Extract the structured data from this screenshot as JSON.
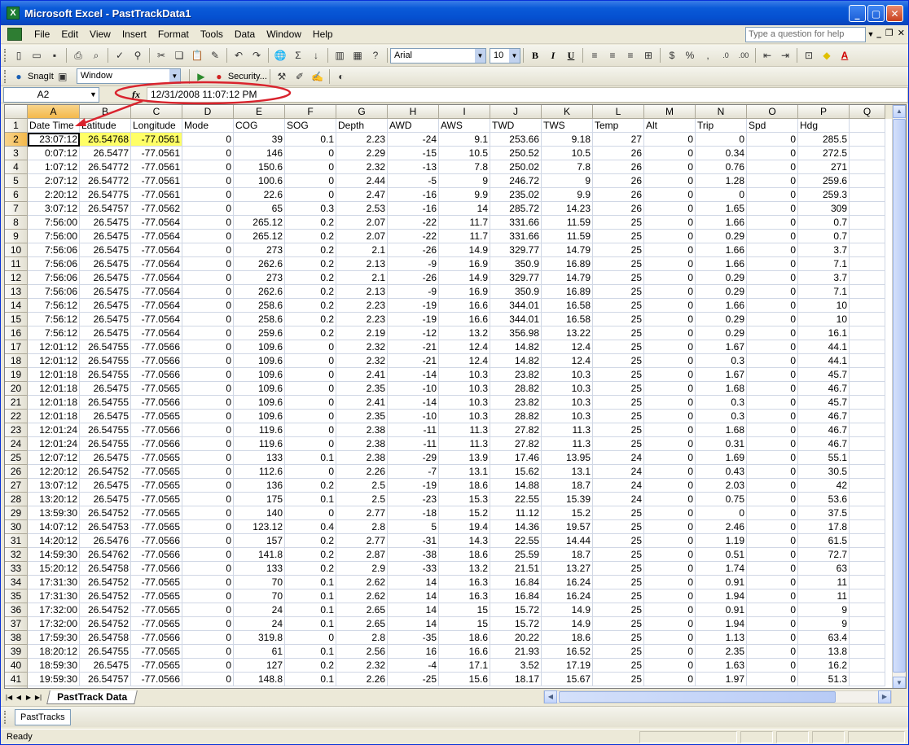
{
  "window": {
    "title": "Microsoft Excel - PastTrackData1"
  },
  "menu": {
    "items": [
      "File",
      "Edit",
      "View",
      "Insert",
      "Format",
      "Tools",
      "Data",
      "Window",
      "Help"
    ],
    "help_placeholder": "Type a question for help"
  },
  "toolbar": {
    "font": "Arial",
    "size": "10",
    "snagit_label": "SnagIt",
    "window_select": "Window",
    "security_label": "Security..."
  },
  "formula_bar": {
    "name_box": "A2",
    "fx": "fx",
    "value": "12/31/2008  11:07:12 PM"
  },
  "grid": {
    "columns": [
      "A",
      "B",
      "C",
      "D",
      "E",
      "F",
      "G",
      "H",
      "I",
      "J",
      "K",
      "L",
      "M",
      "N",
      "O",
      "P",
      "Q"
    ],
    "header_row": [
      "Date Time",
      "Latitude",
      "Longitude",
      "Mode",
      "COG",
      "SOG",
      "Depth",
      "AWD",
      "AWS",
      "TWD",
      "TWS",
      "Temp",
      "Alt",
      "Trip",
      "Spd",
      "Hdg"
    ],
    "rows": [
      [
        "23:07:12",
        "26.54768",
        "-77.0561",
        "0",
        "39",
        "0.1",
        "2.23",
        "-24",
        "9.1",
        "253.66",
        "9.18",
        "27",
        "0",
        "0",
        "0",
        "285.5"
      ],
      [
        "0:07:12",
        "26.5477",
        "-77.0561",
        "0",
        "146",
        "0",
        "2.29",
        "-15",
        "10.5",
        "250.52",
        "10.5",
        "26",
        "0",
        "0.34",
        "0",
        "272.5"
      ],
      [
        "1:07:12",
        "26.54772",
        "-77.0561",
        "0",
        "150.6",
        "0",
        "2.32",
        "-13",
        "7.8",
        "250.02",
        "7.8",
        "26",
        "0",
        "0.76",
        "0",
        "271"
      ],
      [
        "2:07:12",
        "26.54772",
        "-77.0561",
        "0",
        "100.6",
        "0",
        "2.44",
        "-5",
        "9",
        "246.72",
        "9",
        "26",
        "0",
        "1.28",
        "0",
        "259.6"
      ],
      [
        "2:20:12",
        "26.54775",
        "-77.0561",
        "0",
        "22.6",
        "0",
        "2.47",
        "-16",
        "9.9",
        "235.02",
        "9.9",
        "26",
        "0",
        "0",
        "0",
        "259.3"
      ],
      [
        "3:07:12",
        "26.54757",
        "-77.0562",
        "0",
        "65",
        "0.3",
        "2.53",
        "-16",
        "14",
        "285.72",
        "14.23",
        "26",
        "0",
        "1.65",
        "0",
        "309"
      ],
      [
        "7:56:00",
        "26.5475",
        "-77.0564",
        "0",
        "265.12",
        "0.2",
        "2.07",
        "-22",
        "11.7",
        "331.66",
        "11.59",
        "25",
        "0",
        "1.66",
        "0",
        "0.7"
      ],
      [
        "7:56:00",
        "26.5475",
        "-77.0564",
        "0",
        "265.12",
        "0.2",
        "2.07",
        "-22",
        "11.7",
        "331.66",
        "11.59",
        "25",
        "0",
        "0.29",
        "0",
        "0.7"
      ],
      [
        "7:56:06",
        "26.5475",
        "-77.0564",
        "0",
        "273",
        "0.2",
        "2.1",
        "-26",
        "14.9",
        "329.77",
        "14.79",
        "25",
        "0",
        "1.66",
        "0",
        "3.7"
      ],
      [
        "7:56:06",
        "26.5475",
        "-77.0564",
        "0",
        "262.6",
        "0.2",
        "2.13",
        "-9",
        "16.9",
        "350.9",
        "16.89",
        "25",
        "0",
        "1.66",
        "0",
        "7.1"
      ],
      [
        "7:56:06",
        "26.5475",
        "-77.0564",
        "0",
        "273",
        "0.2",
        "2.1",
        "-26",
        "14.9",
        "329.77",
        "14.79",
        "25",
        "0",
        "0.29",
        "0",
        "3.7"
      ],
      [
        "7:56:06",
        "26.5475",
        "-77.0564",
        "0",
        "262.6",
        "0.2",
        "2.13",
        "-9",
        "16.9",
        "350.9",
        "16.89",
        "25",
        "0",
        "0.29",
        "0",
        "7.1"
      ],
      [
        "7:56:12",
        "26.5475",
        "-77.0564",
        "0",
        "258.6",
        "0.2",
        "2.23",
        "-19",
        "16.6",
        "344.01",
        "16.58",
        "25",
        "0",
        "1.66",
        "0",
        "10"
      ],
      [
        "7:56:12",
        "26.5475",
        "-77.0564",
        "0",
        "258.6",
        "0.2",
        "2.23",
        "-19",
        "16.6",
        "344.01",
        "16.58",
        "25",
        "0",
        "0.29",
        "0",
        "10"
      ],
      [
        "7:56:12",
        "26.5475",
        "-77.0564",
        "0",
        "259.6",
        "0.2",
        "2.19",
        "-12",
        "13.2",
        "356.98",
        "13.22",
        "25",
        "0",
        "0.29",
        "0",
        "16.1"
      ],
      [
        "12:01:12",
        "26.54755",
        "-77.0566",
        "0",
        "109.6",
        "0",
        "2.32",
        "-21",
        "12.4",
        "14.82",
        "12.4",
        "25",
        "0",
        "1.67",
        "0",
        "44.1"
      ],
      [
        "12:01:12",
        "26.54755",
        "-77.0566",
        "0",
        "109.6",
        "0",
        "2.32",
        "-21",
        "12.4",
        "14.82",
        "12.4",
        "25",
        "0",
        "0.3",
        "0",
        "44.1"
      ],
      [
        "12:01:18",
        "26.54755",
        "-77.0566",
        "0",
        "109.6",
        "0",
        "2.41",
        "-14",
        "10.3",
        "23.82",
        "10.3",
        "25",
        "0",
        "1.67",
        "0",
        "45.7"
      ],
      [
        "12:01:18",
        "26.5475",
        "-77.0565",
        "0",
        "109.6",
        "0",
        "2.35",
        "-10",
        "10.3",
        "28.82",
        "10.3",
        "25",
        "0",
        "1.68",
        "0",
        "46.7"
      ],
      [
        "12:01:18",
        "26.54755",
        "-77.0566",
        "0",
        "109.6",
        "0",
        "2.41",
        "-14",
        "10.3",
        "23.82",
        "10.3",
        "25",
        "0",
        "0.3",
        "0",
        "45.7"
      ],
      [
        "12:01:18",
        "26.5475",
        "-77.0565",
        "0",
        "109.6",
        "0",
        "2.35",
        "-10",
        "10.3",
        "28.82",
        "10.3",
        "25",
        "0",
        "0.3",
        "0",
        "46.7"
      ],
      [
        "12:01:24",
        "26.54755",
        "-77.0566",
        "0",
        "119.6",
        "0",
        "2.38",
        "-11",
        "11.3",
        "27.82",
        "11.3",
        "25",
        "0",
        "1.68",
        "0",
        "46.7"
      ],
      [
        "12:01:24",
        "26.54755",
        "-77.0566",
        "0",
        "119.6",
        "0",
        "2.38",
        "-11",
        "11.3",
        "27.82",
        "11.3",
        "25",
        "0",
        "0.31",
        "0",
        "46.7"
      ],
      [
        "12:07:12",
        "26.5475",
        "-77.0565",
        "0",
        "133",
        "0.1",
        "2.38",
        "-29",
        "13.9",
        "17.46",
        "13.95",
        "24",
        "0",
        "1.69",
        "0",
        "55.1"
      ],
      [
        "12:20:12",
        "26.54752",
        "-77.0565",
        "0",
        "112.6",
        "0",
        "2.26",
        "-7",
        "13.1",
        "15.62",
        "13.1",
        "24",
        "0",
        "0.43",
        "0",
        "30.5"
      ],
      [
        "13:07:12",
        "26.5475",
        "-77.0565",
        "0",
        "136",
        "0.2",
        "2.5",
        "-19",
        "18.6",
        "14.88",
        "18.7",
        "24",
        "0",
        "2.03",
        "0",
        "42"
      ],
      [
        "13:20:12",
        "26.5475",
        "-77.0565",
        "0",
        "175",
        "0.1",
        "2.5",
        "-23",
        "15.3",
        "22.55",
        "15.39",
        "24",
        "0",
        "0.75",
        "0",
        "53.6"
      ],
      [
        "13:59:30",
        "26.54752",
        "-77.0565",
        "0",
        "140",
        "0",
        "2.77",
        "-18",
        "15.2",
        "11.12",
        "15.2",
        "25",
        "0",
        "0",
        "0",
        "37.5"
      ],
      [
        "14:07:12",
        "26.54753",
        "-77.0565",
        "0",
        "123.12",
        "0.4",
        "2.8",
        "5",
        "19.4",
        "14.36",
        "19.57",
        "25",
        "0",
        "2.46",
        "0",
        "17.8"
      ],
      [
        "14:20:12",
        "26.5476",
        "-77.0566",
        "0",
        "157",
        "0.2",
        "2.77",
        "-31",
        "14.3",
        "22.55",
        "14.44",
        "25",
        "0",
        "1.19",
        "0",
        "61.5"
      ],
      [
        "14:59:30",
        "26.54762",
        "-77.0566",
        "0",
        "141.8",
        "0.2",
        "2.87",
        "-38",
        "18.6",
        "25.59",
        "18.7",
        "25",
        "0",
        "0.51",
        "0",
        "72.7"
      ],
      [
        "15:20:12",
        "26.54758",
        "-77.0566",
        "0",
        "133",
        "0.2",
        "2.9",
        "-33",
        "13.2",
        "21.51",
        "13.27",
        "25",
        "0",
        "1.74",
        "0",
        "63"
      ],
      [
        "17:31:30",
        "26.54752",
        "-77.0565",
        "0",
        "70",
        "0.1",
        "2.62",
        "14",
        "16.3",
        "16.84",
        "16.24",
        "25",
        "0",
        "0.91",
        "0",
        "11"
      ],
      [
        "17:31:30",
        "26.54752",
        "-77.0565",
        "0",
        "70",
        "0.1",
        "2.62",
        "14",
        "16.3",
        "16.84",
        "16.24",
        "25",
        "0",
        "1.94",
        "0",
        "11"
      ],
      [
        "17:32:00",
        "26.54752",
        "-77.0565",
        "0",
        "24",
        "0.1",
        "2.65",
        "14",
        "15",
        "15.72",
        "14.9",
        "25",
        "0",
        "0.91",
        "0",
        "9"
      ],
      [
        "17:32:00",
        "26.54752",
        "-77.0565",
        "0",
        "24",
        "0.1",
        "2.65",
        "14",
        "15",
        "15.72",
        "14.9",
        "25",
        "0",
        "1.94",
        "0",
        "9"
      ],
      [
        "17:59:30",
        "26.54758",
        "-77.0566",
        "0",
        "319.8",
        "0",
        "2.8",
        "-35",
        "18.6",
        "20.22",
        "18.6",
        "25",
        "0",
        "1.13",
        "0",
        "63.4"
      ],
      [
        "18:20:12",
        "26.54755",
        "-77.0565",
        "0",
        "61",
        "0.1",
        "2.56",
        "16",
        "16.6",
        "21.93",
        "16.52",
        "25",
        "0",
        "2.35",
        "0",
        "13.8"
      ],
      [
        "18:59:30",
        "26.5475",
        "-77.0565",
        "0",
        "127",
        "0.2",
        "2.32",
        "-4",
        "17.1",
        "3.52",
        "17.19",
        "25",
        "0",
        "1.63",
        "0",
        "16.2"
      ],
      [
        "19:59:30",
        "26.54757",
        "-77.0566",
        "0",
        "148.8",
        "0.1",
        "2.26",
        "-25",
        "15.6",
        "18.17",
        "15.67",
        "25",
        "0",
        "1.97",
        "0",
        "51.3"
      ]
    ],
    "last_row_number": "42"
  },
  "sheet_tab": "PastTrack Data",
  "drawbar": {
    "button": "PastTracks"
  },
  "status": {
    "text": "Ready"
  },
  "colors": {
    "highlight": "#ffff66",
    "annotation": "#d9232d"
  }
}
